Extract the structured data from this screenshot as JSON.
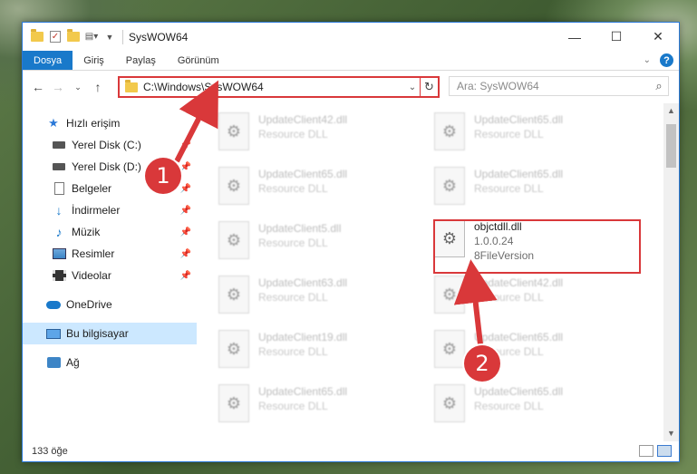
{
  "window": {
    "title": "SysWOW64",
    "controls": [
      "minimize",
      "maximize",
      "close"
    ]
  },
  "ribbon": {
    "tabs": [
      {
        "label": "Dosya",
        "active": true
      },
      {
        "label": "Giriş",
        "active": false
      },
      {
        "label": "Paylaş",
        "active": false
      },
      {
        "label": "Görünüm",
        "active": false
      }
    ],
    "help_label": "?"
  },
  "navbar": {
    "address": "C:\\Windows\\SysWOW64",
    "search_placeholder": "Ara: SysWOW64"
  },
  "nav_pane": {
    "quick_access": "Hızlı erişim",
    "items": [
      {
        "label": "Yerel Disk (C:)",
        "icon": "drive-icon",
        "pinned": true
      },
      {
        "label": "Yerel Disk (D:)",
        "icon": "drive-icon",
        "pinned": true
      },
      {
        "label": "Belgeler",
        "icon": "documents-icon",
        "pinned": true
      },
      {
        "label": "İndirmeler",
        "icon": "downloads-icon",
        "pinned": true
      },
      {
        "label": "Müzik",
        "icon": "music-icon",
        "pinned": true
      },
      {
        "label": "Resimler",
        "icon": "pictures-icon",
        "pinned": true
      },
      {
        "label": "Videolar",
        "icon": "videos-icon",
        "pinned": true
      }
    ],
    "onedrive": "OneDrive",
    "this_pc": "Bu bilgisayar",
    "network": "Ağ"
  },
  "files": [
    {
      "name": "UpdateClient42.dll",
      "desc": "Resource DLL"
    },
    {
      "name": "UpdateClient65.dll",
      "desc": "Resource DLL"
    },
    {
      "name": "UpdateClient65.dll",
      "desc": "Resource DLL"
    },
    {
      "name": "UpdateClient65.dll",
      "desc": "Resource DLL"
    },
    {
      "name": "UpdateClient5.dll",
      "desc": "Resource DLL"
    },
    {
      "name": "objctdll.dll",
      "desc": "1.0.0.24",
      "desc2": "8FileVersion",
      "highlighted": true
    },
    {
      "name": "UpdateClient63.dll",
      "desc": "Resource DLL"
    },
    {
      "name": "UpdateClient42.dll",
      "desc": "Resource DLL"
    },
    {
      "name": "UpdateClient19.dll",
      "desc": "Resource DLL"
    },
    {
      "name": "UpdateClient65.dll",
      "desc": "Resource DLL"
    },
    {
      "name": "UpdateClient65.dll",
      "desc": "Resource DLL"
    },
    {
      "name": "UpdateClient65.dll",
      "desc": "Resource DLL"
    }
  ],
  "status": {
    "count": "133 öğe"
  },
  "annotations": {
    "step1": "1",
    "step2": "2",
    "color": "#d9383a"
  },
  "colors": {
    "accent": "#1979ca",
    "highlight_red": "#d9383a",
    "selected_bg": "#cce8ff"
  }
}
